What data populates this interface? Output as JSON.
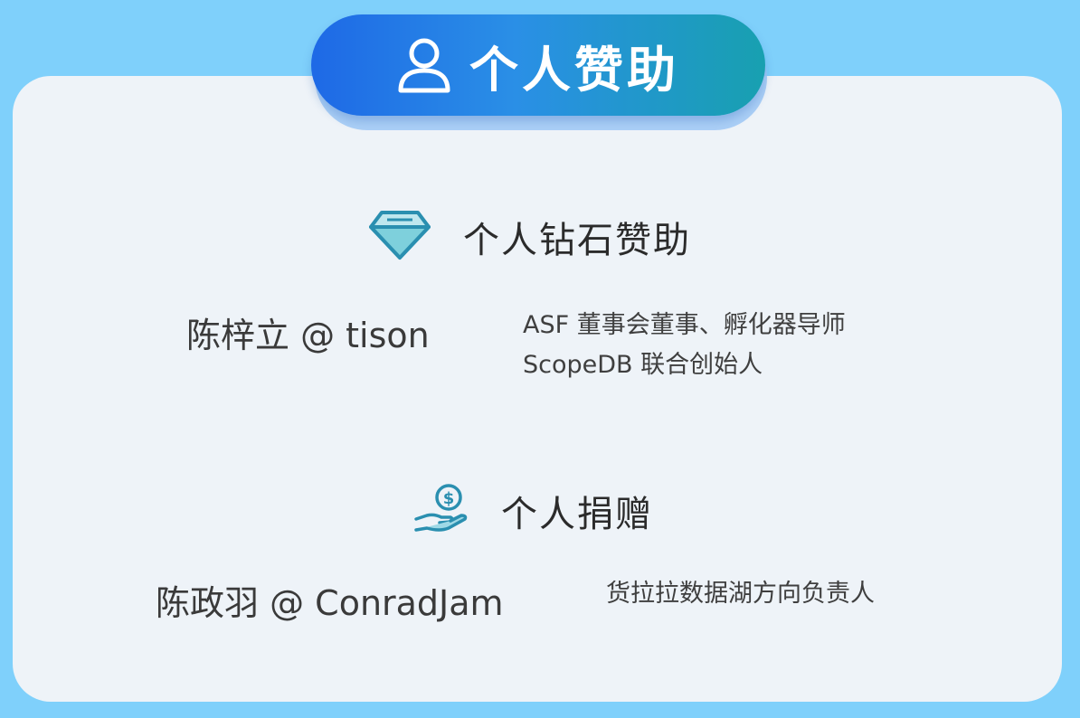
{
  "header": {
    "title": "个人赞助",
    "icon": "user-icon"
  },
  "sections": [
    {
      "title": "个人钻石赞助",
      "icon": "diamond-icon",
      "entries": [
        {
          "name": "陈梓立 @ tison",
          "desc_lines": [
            "ASF 董事会董事、孵化器导师",
            "ScopeDB 联合创始人"
          ]
        }
      ]
    },
    {
      "title": "个人捐赠",
      "icon": "donation-hand-icon",
      "entries": [
        {
          "name": "陈政羽 @ ConradJam",
          "desc_lines": [
            "货拉拉数据湖方向负责人"
          ]
        }
      ]
    }
  ],
  "colors": {
    "background": "#7fd0fb",
    "card": "#eef3f8",
    "banner_start": "#1e69e6",
    "banner_end": "#18a0b0",
    "icon_teal": "#2a8fb0"
  }
}
